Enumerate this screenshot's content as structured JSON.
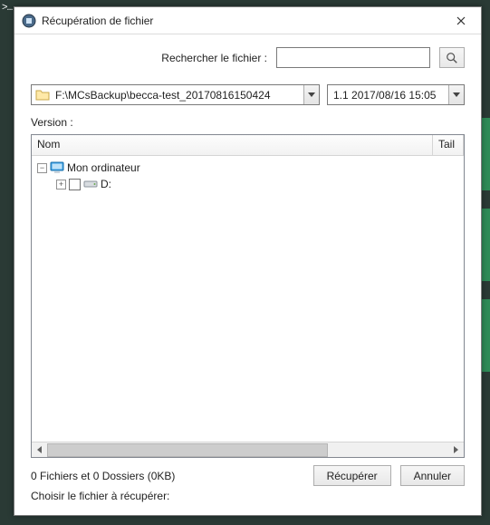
{
  "window": {
    "title": "Récupération de fichier",
    "close_aria": "Close"
  },
  "search": {
    "label": "Rechercher le fichier :",
    "value": "",
    "placeholder": ""
  },
  "path_combo": {
    "value": "F:\\MCsBackup\\becca-test_20170816150424"
  },
  "version_combo": {
    "value": "1.1  2017/08/16 15:05"
  },
  "version_label": "Version :",
  "columns": {
    "name": "Nom",
    "tail": "Tail"
  },
  "tree": {
    "root": {
      "label": "Mon ordinateur",
      "expanded": true
    },
    "child": {
      "label": "D:",
      "expanded": false,
      "checked": false
    }
  },
  "footer": {
    "status": "0 Fichiers et 0 Dossiers (0KB)",
    "hint": "Choisir le fichier à récupérer:",
    "recover": "Récupérer",
    "cancel": "Annuler"
  }
}
